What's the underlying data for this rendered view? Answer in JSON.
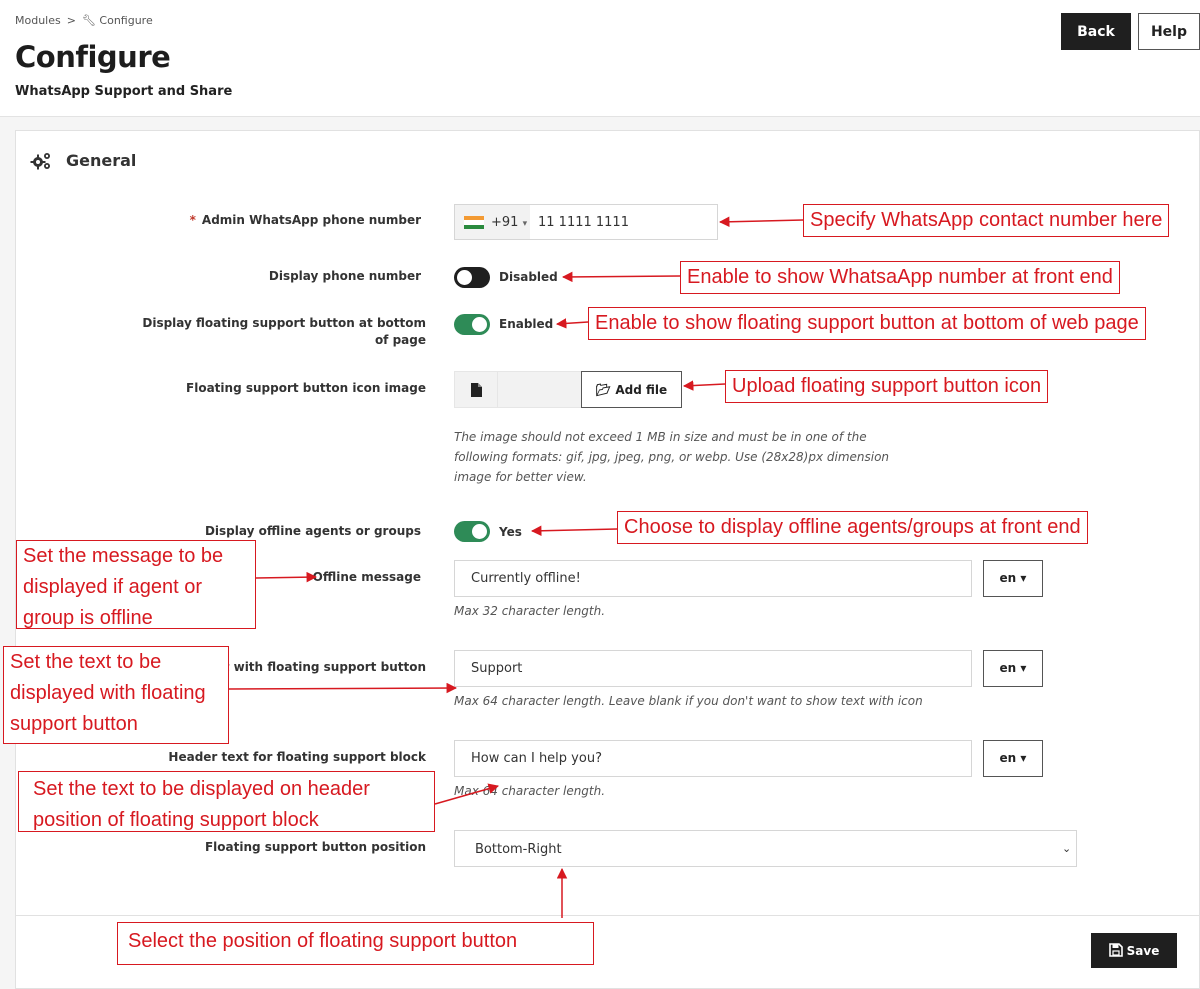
{
  "breadcrumb": {
    "root": "Modules",
    "separator": ">",
    "icon": "wrench-icon",
    "current": "Configure"
  },
  "page": {
    "title": "Configure",
    "subtitle": "WhatsApp Support and Share"
  },
  "header_buttons": {
    "back": "Back",
    "help": "Help"
  },
  "section": {
    "icon": "gears-icon",
    "title": "General"
  },
  "fields": {
    "phone": {
      "label": "Admin WhatsApp phone number",
      "required_mark": "*",
      "dial_code": "+91",
      "dial_arrow": "▾",
      "value": "11 1111 1111",
      "flag": "india-flag-icon"
    },
    "display_phone": {
      "label": "Display phone number",
      "state_text": "Disabled",
      "enabled": false
    },
    "floating_button": {
      "label": "Display floating support button at bottom of page",
      "state_text": "Enabled",
      "enabled": true
    },
    "icon_image": {
      "label": "Floating support button icon image",
      "file_icon": "file-icon",
      "add_file": "Add file",
      "add_file_icon": "folder-open-icon",
      "help": "The image should not exceed 1 MB in size and must be in one of the following formats: gif, jpg, jpeg, png, or webp. Use (28x28)px dimension image for better view."
    },
    "offline_agents": {
      "label": "Display offline agents or groups",
      "state_text": "Yes",
      "enabled": true
    },
    "offline_message": {
      "label": "Offline message",
      "value": "Currently offline!",
      "lang": "en ▾",
      "help": "Max 32 character length."
    },
    "floating_text": {
      "label": "Text with floating support button",
      "value": "Support",
      "lang": "en ▾",
      "help": "Max 64 character length. Leave blank if you don't want to show text with icon"
    },
    "header_text": {
      "label": "Header text for floating support block",
      "value": "How can I help you?",
      "lang": "en ▾",
      "help": "Max 64 character length."
    },
    "position": {
      "label": "Floating support button position",
      "value": "Bottom-Right",
      "chevron": "⌄"
    }
  },
  "save": {
    "label": "Save",
    "icon": "floppy-disk-icon"
  },
  "annotations": {
    "phone": "Specify WhatsApp contact number here",
    "display_phone": "Enable to show WhatsaApp number at front end",
    "floating_button": "Enable to show floating support button at bottom of web page",
    "icon_image": "Upload floating support button icon",
    "offline_agents": "Choose to display offline agents/groups at front end",
    "offline_message": "Set the message to be displayed if agent or group is offline",
    "floating_text": "Set the text to be displayed with floating support button",
    "header_text": "Set the text to be displayed on header position of floating support block",
    "position": "Select the position of floating support button"
  },
  "colors": {
    "annotation": "#d71920",
    "toggle_on": "#2e8b57",
    "toggle_off": "#1f1f1f",
    "dark_button": "#1f1f1f"
  }
}
